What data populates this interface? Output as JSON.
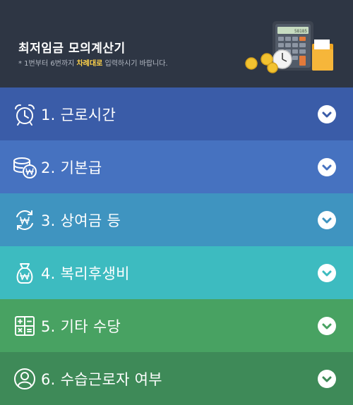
{
  "header": {
    "title": "최저임금 모의계산기",
    "subtitle_pre": "* 1번부터 6번까지 ",
    "subtitle_highlight": "차례대로",
    "subtitle_post": " 입력하시기 바랍니다.",
    "calculator_display": "58185"
  },
  "sections": [
    {
      "label": "1. 근로시간",
      "icon": "alarm-clock-icon",
      "color": "#3a5ca8"
    },
    {
      "label": "2. 기본급",
      "icon": "coins-won-icon",
      "color": "#4672c0"
    },
    {
      "label": "3. 상여금 등",
      "icon": "won-cycle-icon",
      "color": "#3f94c0"
    },
    {
      "label": "4. 복리후생비",
      "icon": "money-bag-icon",
      "color": "#3dbbc0"
    },
    {
      "label": "5. 기타 수당",
      "icon": "calculator-icon",
      "color": "#48a262"
    },
    {
      "label": "6. 수습근로자 여부",
      "icon": "person-icon",
      "color": "#3e8a58"
    }
  ],
  "colors": {
    "header_bg": "#2e3644",
    "highlight": "#ffd24a"
  }
}
